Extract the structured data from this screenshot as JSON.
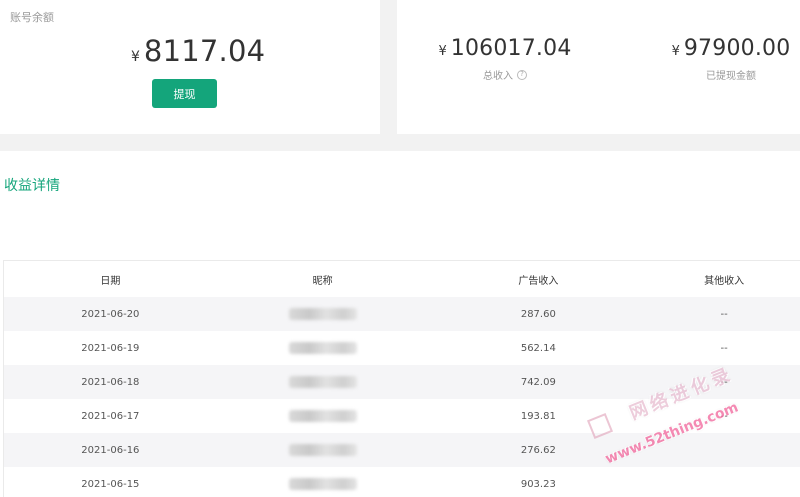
{
  "balance": {
    "label": "账号余额",
    "currency": "¥",
    "amount": "8117.04",
    "withdraw_label": "提现"
  },
  "stats": {
    "total_income": {
      "currency": "¥",
      "amount": "106017.04",
      "label": "总收入",
      "help": "?"
    },
    "withdrawn": {
      "currency": "¥",
      "amount": "97900.00",
      "label": "已提现金额"
    }
  },
  "details": {
    "title": "收益详情",
    "columns": [
      "日期",
      "昵称",
      "广告收入",
      "其他收入"
    ],
    "rows": [
      {
        "date": "2021-06-20",
        "ad": "287.60",
        "other": "--"
      },
      {
        "date": "2021-06-19",
        "ad": "562.14",
        "other": "--"
      },
      {
        "date": "2021-06-18",
        "ad": "742.09",
        "other": "--"
      },
      {
        "date": "2021-06-17",
        "ad": "193.81",
        "other": "--"
      },
      {
        "date": "2021-06-16",
        "ad": "276.62",
        "other": ""
      },
      {
        "date": "2021-06-15",
        "ad": "903.23",
        "other": ""
      }
    ]
  },
  "watermark": {
    "cn": "网络进化录",
    "url": "www.52thing.com"
  },
  "colors": {
    "accent": "#14a57b",
    "page_bg": "#f2f2f2",
    "stripe": "#f5f5f7"
  }
}
